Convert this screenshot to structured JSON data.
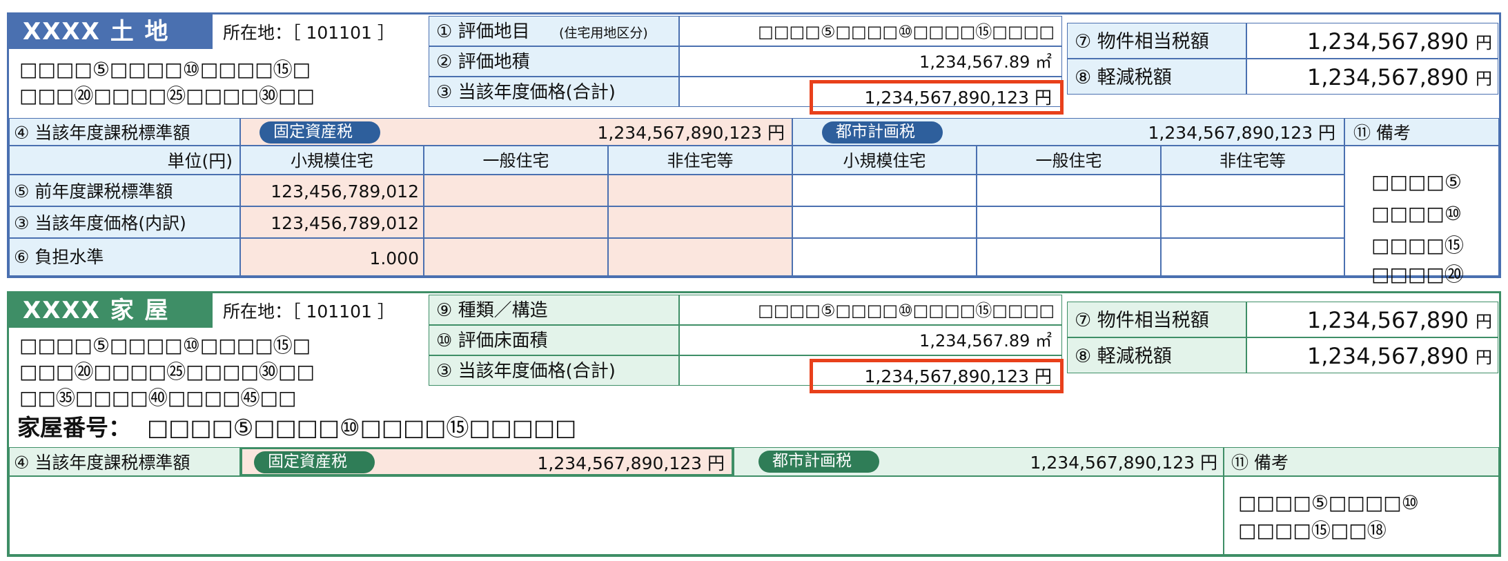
{
  "land": {
    "title": "XXXX 土 地",
    "location_label": "所在地：［ 101101 ］",
    "address_line1": "□□□□⑤□□□□⑩□□□□⑮□",
    "address_line2": "□□□⑳□□□□㉕□□□□㉚□□",
    "item1_label": "① 評価地目",
    "item1_sub": "(住宅用地区分)",
    "item1_value": "□□□□⑤□□□□⑩□□□□⑮□□□□",
    "item2_label": "② 評価地積",
    "item2_value": "1,234,567.89 ㎡",
    "item3_label": "③ 当該年度価格(合計)",
    "item3_value": "1,234,567,890,123 円",
    "item7_label": "⑦ 物件相当税額",
    "item7_value": "1,234,567,890",
    "item8_label": "⑧ 軽減税額",
    "item8_value": "1,234,567,890",
    "yen": "円",
    "item4_label": "④ 当該年度課税標準額",
    "fixed_tax_badge": "固定資産税",
    "fixed_tax_value": "1,234,567,890,123 円",
    "city_tax_badge": "都市計画税",
    "city_tax_value": "1,234,567,890,123 円",
    "remarks_label": "⑪ 備考",
    "unit_label": "単位(円)",
    "col_small": "小規模住宅",
    "col_general": "一般住宅",
    "col_nonres": "非住宅等",
    "row5_label": "⑤ 前年度課税標準額",
    "row5_small": "123,456,789,012",
    "row3_label": "③ 当該年度価格(内訳)",
    "row3_small": "123,456,789,012",
    "row6_label": "⑥ 負担水準",
    "row6_small": "1.000",
    "remarks_lines": [
      "□□□□⑤",
      "□□□□⑩",
      "□□□□⑮",
      "□□□□⑳"
    ]
  },
  "house": {
    "title": "XXXX 家 屋",
    "location_label": "所在地：［ 101101 ］",
    "address_line1": "□□□□⑤□□□□⑩□□□□⑮□",
    "address_line2": "□□□⑳□□□□㉕□□□□㉚□□",
    "address_line3": "□□㉟□□□□㊵□□□□㊺□□",
    "house_no_label": "家屋番号：",
    "house_no_value": "□□□□⑤□□□□⑩□□□□⑮□□□□□",
    "item9_label": "⑨ 種類／構造",
    "item9_value": "□□□□⑤□□□□⑩□□□□⑮□□□□",
    "item10_label": "⑩ 評価床面積",
    "item10_value": "1,234,567.89 ㎡",
    "item3_label": "③ 当該年度価格(合計)",
    "item3_value": "1,234,567,890,123 円",
    "item7_label": "⑦ 物件相当税額",
    "item7_value": "1,234,567,890",
    "item8_label": "⑧ 軽減税額",
    "item8_value": "1,234,567,890",
    "yen": "円",
    "item4_label": "④ 当該年度課税標準額",
    "fixed_tax_badge": "固定資産税",
    "fixed_tax_value": "1,234,567,890,123 円",
    "city_tax_badge": "都市計画税",
    "city_tax_value": "1,234,567,890,123 円",
    "remarks_label": "⑪ 備考",
    "remarks_lines": [
      "□□□□⑤□□□□⑩",
      "□□□□⑮□□⑱"
    ]
  }
}
